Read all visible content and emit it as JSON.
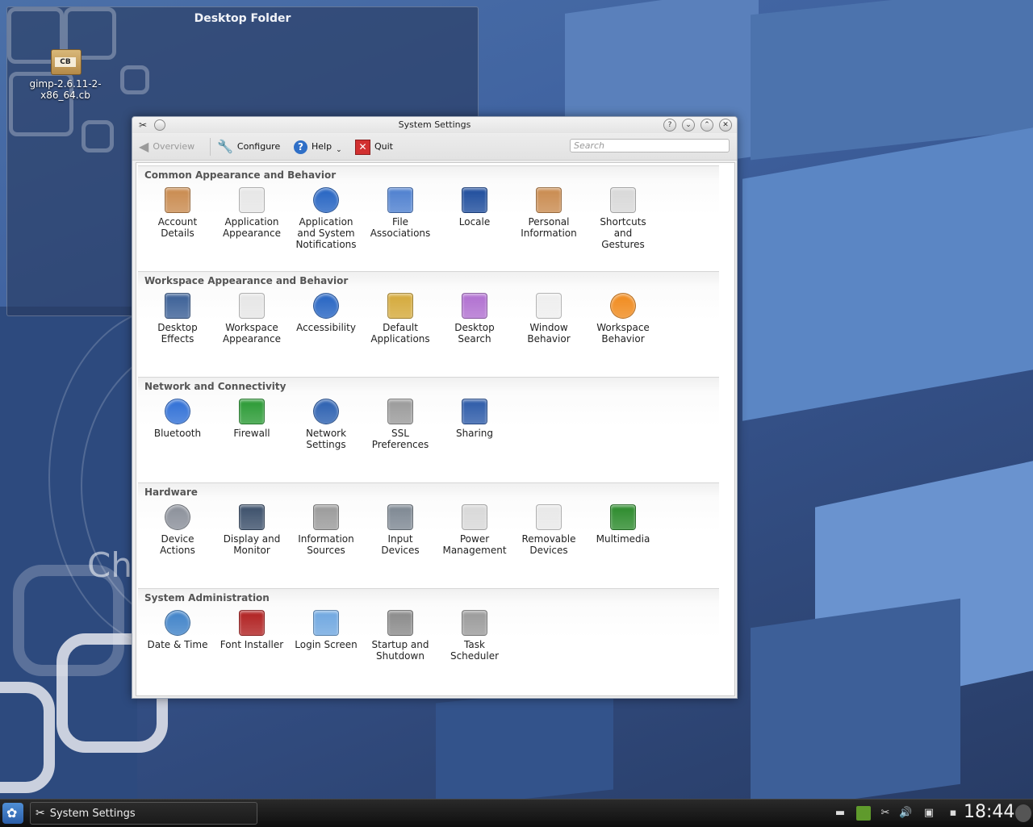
{
  "desktop": {
    "folder_title": "Desktop Folder",
    "file": {
      "name": "gimp-2.6.11-2-\nx86_64.cb",
      "icon": "package-cb-icon",
      "badge": "CB"
    }
  },
  "window": {
    "title": "System Settings",
    "toolbar": {
      "overview": "Overview",
      "configure": "Configure",
      "help": "Help",
      "quit": "Quit",
      "search_placeholder": "Search"
    }
  },
  "sections": [
    {
      "title": "Common Appearance and Behavior",
      "items": [
        {
          "label": "Account\nDetails",
          "icon": "account-icon"
        },
        {
          "label": "Application\nAppearance",
          "icon": "appearance-icon"
        },
        {
          "label": "Application\nand System\nNotifications",
          "icon": "notification-icon"
        },
        {
          "label": "File\nAssociations",
          "icon": "file-associations-icon"
        },
        {
          "label": "Locale",
          "icon": "locale-icon"
        },
        {
          "label": "Personal\nInformation",
          "icon": "personal-info-icon"
        },
        {
          "label": "Shortcuts\nand\nGestures",
          "icon": "keyboard-icon"
        }
      ]
    },
    {
      "title": "Workspace Appearance and Behavior",
      "items": [
        {
          "label": "Desktop\nEffects",
          "icon": "desktop-effects-icon"
        },
        {
          "label": "Workspace\nAppearance",
          "icon": "workspace-appearance-icon"
        },
        {
          "label": "Accessibility",
          "icon": "accessibility-icon"
        },
        {
          "label": "Default\nApplications",
          "icon": "default-apps-icon"
        },
        {
          "label": "Desktop\nSearch",
          "icon": "desktop-search-icon"
        },
        {
          "label": "Window\nBehavior",
          "icon": "window-behavior-icon"
        },
        {
          "label": "Workspace\nBehavior",
          "icon": "workspace-behavior-icon"
        }
      ]
    },
    {
      "title": "Network and Connectivity",
      "items": [
        {
          "label": "Bluetooth",
          "icon": "bluetooth-icon"
        },
        {
          "label": "Firewall",
          "icon": "firewall-icon"
        },
        {
          "label": "Network\nSettings",
          "icon": "network-icon"
        },
        {
          "label": "SSL\nPreferences",
          "icon": "ssl-tools-icon"
        },
        {
          "label": "Sharing",
          "icon": "sharing-icon"
        }
      ]
    },
    {
      "title": "Hardware",
      "items": [
        {
          "label": "Device\nActions",
          "icon": "device-actions-icon"
        },
        {
          "label": "Display and\nMonitor",
          "icon": "monitor-icon"
        },
        {
          "label": "Information\nSources",
          "icon": "info-sources-icon"
        },
        {
          "label": "Input\nDevices",
          "icon": "input-devices-icon"
        },
        {
          "label": "Power\nManagement",
          "icon": "power-icon"
        },
        {
          "label": "Removable\nDevices",
          "icon": "removable-icon"
        },
        {
          "label": "Multimedia",
          "icon": "multimedia-icon"
        }
      ]
    },
    {
      "title": "System Administration",
      "items": [
        {
          "label": "Date & Time",
          "icon": "clock-icon"
        },
        {
          "label": "Font Installer",
          "icon": "font-icon"
        },
        {
          "label": "Login Screen",
          "icon": "login-screen-icon"
        },
        {
          "label": "Startup and\nShutdown",
          "icon": "startup-icon"
        },
        {
          "label": "Task\nScheduler",
          "icon": "scheduler-icon"
        }
      ]
    }
  ],
  "taskbar": {
    "task_label": "System Settings",
    "clock": "18:44"
  }
}
